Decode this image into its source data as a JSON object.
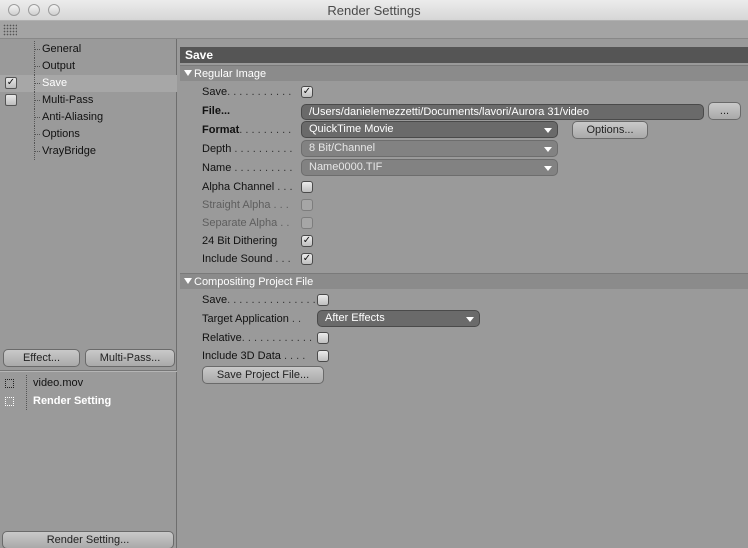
{
  "window": {
    "title": "Render Settings"
  },
  "sidebar": {
    "items": [
      {
        "label": "General",
        "checked": null
      },
      {
        "label": "Output",
        "checked": null
      },
      {
        "label": "Save",
        "checked": true
      },
      {
        "label": "Multi-Pass",
        "checked": false
      },
      {
        "label": "Anti-Aliasing",
        "checked": null
      },
      {
        "label": "Options",
        "checked": null
      },
      {
        "label": "VrayBridge",
        "checked": null
      }
    ],
    "effect_button": "Effect...",
    "multipass_button": "Multi-Pass...",
    "render_list": [
      {
        "label": "video.mov"
      },
      {
        "label": "Render Setting"
      }
    ],
    "render_setting_button": "Render Setting..."
  },
  "main": {
    "section_title": "Save",
    "regular_image": {
      "title": "Regular Image",
      "save_label": "Save",
      "save_checked": true,
      "file_label": "File...",
      "file_value": "/Users/danielemezzetti/Documents/lavori/Aurora 31/video",
      "file_browse_button": "...",
      "format_label": "Format",
      "format_value": "QuickTime Movie",
      "format_options_button": "Options...",
      "depth_label": "Depth",
      "depth_value": "8 Bit/Channel",
      "name_label": "Name",
      "name_value": "Name0000.TIF",
      "alpha_channel_label": "Alpha Channel",
      "alpha_channel_checked": false,
      "straight_alpha_label": "Straight Alpha",
      "straight_alpha_checked": false,
      "separate_alpha_label": "Separate Alpha",
      "separate_alpha_checked": false,
      "dithering_label": "24 Bit Dithering",
      "dithering_checked": true,
      "include_sound_label": "Include Sound",
      "include_sound_checked": true
    },
    "compositing": {
      "title": "Compositing Project File",
      "save_label": "Save",
      "save_checked": false,
      "target_app_label": "Target Application",
      "target_app_value": "After Effects",
      "relative_label": "Relative",
      "relative_checked": false,
      "include_3d_label": "Include 3D Data",
      "include_3d_checked": false,
      "save_project_button": "Save Project File..."
    }
  },
  "icons": {
    "check": "✓"
  },
  "colors": {
    "header_dark": "#555555",
    "field_bg": "#6a6a6a",
    "panel_bg": "#9a9a9a"
  }
}
